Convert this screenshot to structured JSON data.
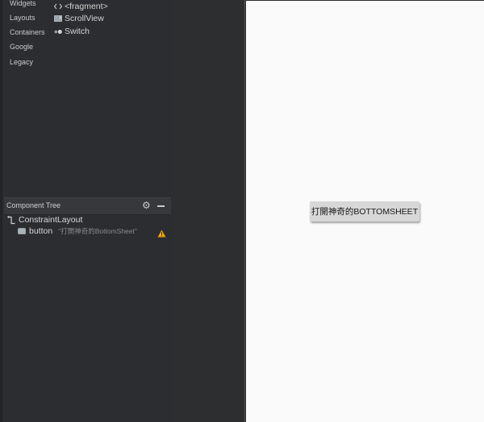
{
  "palette": {
    "categories": [
      "Widgets",
      "Layouts",
      "Containers",
      "Google",
      "Legacy"
    ],
    "items": [
      {
        "label": "<fragment>",
        "icon": "fragment-icon"
      },
      {
        "label": "ScrollView",
        "icon": "scrollview-icon"
      },
      {
        "label": "Switch",
        "icon": "switch-icon"
      }
    ]
  },
  "component_tree": {
    "title": "Component Tree",
    "root": {
      "label": "ConstraintLayout",
      "icon": "constraint-layout-icon"
    },
    "child": {
      "label": "button",
      "text": "\"打開神奇的BottomSheet\"",
      "icon": "button-icon",
      "warning": true
    }
  },
  "preview": {
    "button_label": "打開神奇的BOTTOMSHEET"
  },
  "colors": {
    "panel": "#2b2d30",
    "canvas": "#fafafa",
    "warning": "#f0a30a"
  }
}
